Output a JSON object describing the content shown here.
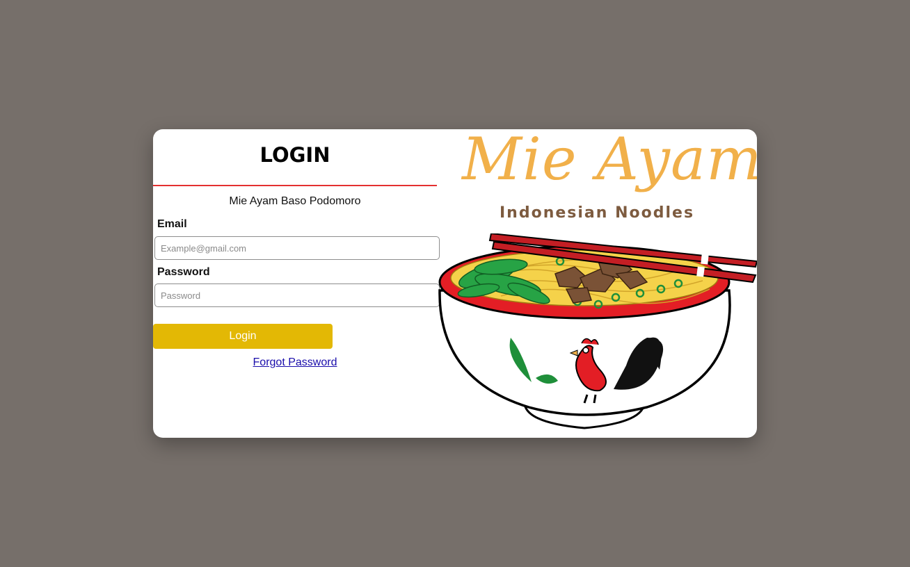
{
  "login": {
    "title": "LOGIN",
    "subtitle": "Mie Ayam Baso Podomoro",
    "email_label": "Email",
    "email_placeholder": "Example@gmail.com",
    "email_value": "",
    "password_label": "Password",
    "password_placeholder": "Password",
    "password_value": "",
    "button_label": "Login",
    "forgot_label": "Forgot Password"
  },
  "brand": {
    "script_title": "Mie Ayam",
    "subtitle": "Indonesian Noodles"
  },
  "colors": {
    "background": "#766f6a",
    "accent_rule": "#e43030",
    "button": "#e3b805",
    "brand_script": "#f1b04a",
    "brand_sub": "#7d5b3f",
    "link": "#1a0dab"
  },
  "icons": [
    "rooster-bowl-icon",
    "chopsticks-icon"
  ]
}
